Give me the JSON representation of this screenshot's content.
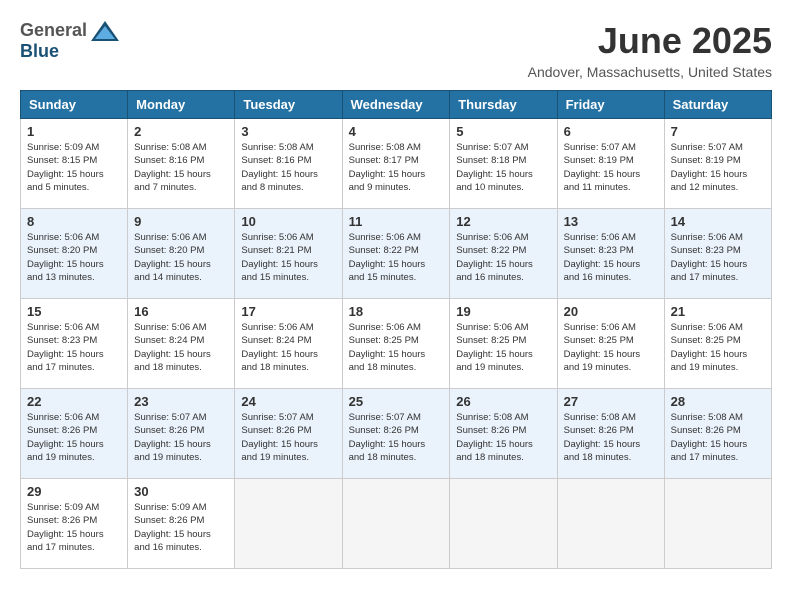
{
  "logo": {
    "general": "General",
    "blue": "Blue"
  },
  "title": "June 2025",
  "location": "Andover, Massachusetts, United States",
  "days_of_week": [
    "Sunday",
    "Monday",
    "Tuesday",
    "Wednesday",
    "Thursday",
    "Friday",
    "Saturday"
  ],
  "weeks": [
    [
      {
        "day": "1",
        "sunrise": "5:09 AM",
        "sunset": "8:15 PM",
        "daylight": "15 hours and 5 minutes."
      },
      {
        "day": "2",
        "sunrise": "5:08 AM",
        "sunset": "8:16 PM",
        "daylight": "15 hours and 7 minutes."
      },
      {
        "day": "3",
        "sunrise": "5:08 AM",
        "sunset": "8:16 PM",
        "daylight": "15 hours and 8 minutes."
      },
      {
        "day": "4",
        "sunrise": "5:08 AM",
        "sunset": "8:17 PM",
        "daylight": "15 hours and 9 minutes."
      },
      {
        "day": "5",
        "sunrise": "5:07 AM",
        "sunset": "8:18 PM",
        "daylight": "15 hours and 10 minutes."
      },
      {
        "day": "6",
        "sunrise": "5:07 AM",
        "sunset": "8:19 PM",
        "daylight": "15 hours and 11 minutes."
      },
      {
        "day": "7",
        "sunrise": "5:07 AM",
        "sunset": "8:19 PM",
        "daylight": "15 hours and 12 minutes."
      }
    ],
    [
      {
        "day": "8",
        "sunrise": "5:06 AM",
        "sunset": "8:20 PM",
        "daylight": "15 hours and 13 minutes."
      },
      {
        "day": "9",
        "sunrise": "5:06 AM",
        "sunset": "8:20 PM",
        "daylight": "15 hours and 14 minutes."
      },
      {
        "day": "10",
        "sunrise": "5:06 AM",
        "sunset": "8:21 PM",
        "daylight": "15 hours and 15 minutes."
      },
      {
        "day": "11",
        "sunrise": "5:06 AM",
        "sunset": "8:22 PM",
        "daylight": "15 hours and 15 minutes."
      },
      {
        "day": "12",
        "sunrise": "5:06 AM",
        "sunset": "8:22 PM",
        "daylight": "15 hours and 16 minutes."
      },
      {
        "day": "13",
        "sunrise": "5:06 AM",
        "sunset": "8:23 PM",
        "daylight": "15 hours and 16 minutes."
      },
      {
        "day": "14",
        "sunrise": "5:06 AM",
        "sunset": "8:23 PM",
        "daylight": "15 hours and 17 minutes."
      }
    ],
    [
      {
        "day": "15",
        "sunrise": "5:06 AM",
        "sunset": "8:23 PM",
        "daylight": "15 hours and 17 minutes."
      },
      {
        "day": "16",
        "sunrise": "5:06 AM",
        "sunset": "8:24 PM",
        "daylight": "15 hours and 18 minutes."
      },
      {
        "day": "17",
        "sunrise": "5:06 AM",
        "sunset": "8:24 PM",
        "daylight": "15 hours and 18 minutes."
      },
      {
        "day": "18",
        "sunrise": "5:06 AM",
        "sunset": "8:25 PM",
        "daylight": "15 hours and 18 minutes."
      },
      {
        "day": "19",
        "sunrise": "5:06 AM",
        "sunset": "8:25 PM",
        "daylight": "15 hours and 19 minutes."
      },
      {
        "day": "20",
        "sunrise": "5:06 AM",
        "sunset": "8:25 PM",
        "daylight": "15 hours and 19 minutes."
      },
      {
        "day": "21",
        "sunrise": "5:06 AM",
        "sunset": "8:25 PM",
        "daylight": "15 hours and 19 minutes."
      }
    ],
    [
      {
        "day": "22",
        "sunrise": "5:06 AM",
        "sunset": "8:26 PM",
        "daylight": "15 hours and 19 minutes."
      },
      {
        "day": "23",
        "sunrise": "5:07 AM",
        "sunset": "8:26 PM",
        "daylight": "15 hours and 19 minutes."
      },
      {
        "day": "24",
        "sunrise": "5:07 AM",
        "sunset": "8:26 PM",
        "daylight": "15 hours and 19 minutes."
      },
      {
        "day": "25",
        "sunrise": "5:07 AM",
        "sunset": "8:26 PM",
        "daylight": "15 hours and 18 minutes."
      },
      {
        "day": "26",
        "sunrise": "5:08 AM",
        "sunset": "8:26 PM",
        "daylight": "15 hours and 18 minutes."
      },
      {
        "day": "27",
        "sunrise": "5:08 AM",
        "sunset": "8:26 PM",
        "daylight": "15 hours and 18 minutes."
      },
      {
        "day": "28",
        "sunrise": "5:08 AM",
        "sunset": "8:26 PM",
        "daylight": "15 hours and 17 minutes."
      }
    ],
    [
      {
        "day": "29",
        "sunrise": "5:09 AM",
        "sunset": "8:26 PM",
        "daylight": "15 hours and 17 minutes."
      },
      {
        "day": "30",
        "sunrise": "5:09 AM",
        "sunset": "8:26 PM",
        "daylight": "15 hours and 16 minutes."
      },
      null,
      null,
      null,
      null,
      null
    ]
  ]
}
